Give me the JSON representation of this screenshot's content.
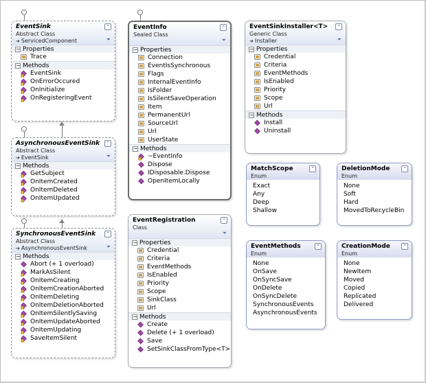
{
  "boxes": {
    "eventsink": {
      "title": "EventSink",
      "kind": "Abstract Class",
      "base": "ServicedComponent",
      "props_label": "Properties",
      "props": [
        "Trace"
      ],
      "methods_label": "Methods",
      "methods": [
        "EventSink",
        "OnErrorOccured",
        "OnInitialize",
        "OnRegisteringEvent"
      ]
    },
    "async": {
      "title": "AsynchronousEventSink",
      "kind": "Abstract Class",
      "base": "EventSink",
      "methods_label": "Methods",
      "methods": [
        "GetSubject",
        "OnItemCreated",
        "OnItemDeleted",
        "OnItemUpdated"
      ]
    },
    "sync": {
      "title": "SynchronousEventSink",
      "kind": "Abstract Class",
      "base": "AsynchronousEventSink",
      "methods_label": "Methods",
      "methods": [
        "Abort (+ 1 overload)",
        "MarkAsSilent",
        "OnItemCreating",
        "OnItemCreationAborted",
        "OnItemDeleting",
        "OnItemDeletionAborted",
        "OnItemSilentlySaving",
        "OnItemUpdateAborted",
        "OnItemUpdating",
        "SaveItemSilent"
      ]
    },
    "eventinfo": {
      "title": "EventInfo",
      "kind": "Sealed Class",
      "props_label": "Properties",
      "props": [
        "Connection",
        "EventIsSynchronous",
        "Flags",
        "InternalEventInfo",
        "IsFolder",
        "IsSilentSaveOperation",
        "Item",
        "PermanentUrl",
        "SourceUrl",
        "Url",
        "UserState"
      ],
      "methods_label": "Methods",
      "methods": [
        "~EventInfo",
        "Dispose",
        "IDisposable.Dispose",
        "OpenItemLocally"
      ]
    },
    "eventreg": {
      "title": "EventRegistration",
      "kind": "Class",
      "props_label": "Properties",
      "props": [
        "Credential",
        "Criteria",
        "EventMethods",
        "IsEnabled",
        "Priority",
        "Scope",
        "SinkClass",
        "Url"
      ],
      "methods_label": "Methods",
      "methods": [
        "Create",
        "Delete (+ 1 overload)",
        "Save",
        "SetSinkClassFromType<T>"
      ]
    },
    "installer": {
      "title": "EventSinkInstaller<T>",
      "kind": "Generic Class",
      "base": "Installer",
      "props_label": "Properties",
      "props": [
        "Credential",
        "Criteria",
        "EventMethods",
        "IsEnabled",
        "Priority",
        "Scope",
        "Url"
      ],
      "methods_label": "Methods",
      "methods": [
        "Install",
        "Uninstall"
      ]
    },
    "matchscope": {
      "title": "MatchScope",
      "kind": "Enum",
      "values": [
        "Exact",
        "Any",
        "Deep",
        "Shallow"
      ]
    },
    "deletionmode": {
      "title": "DeletionMode",
      "kind": "Enum",
      "values": [
        "None",
        "Soft",
        "Hard",
        "MovedToRecycleBin"
      ]
    },
    "eventmethods": {
      "title": "EventMethods",
      "kind": "Enum",
      "values": [
        "None",
        "OnSave",
        "OnSyncSave",
        "OnDelete",
        "OnSyncDelete",
        "SynchronousEvents",
        "AsynchronousEvents"
      ]
    },
    "creationmode": {
      "title": "CreationMode",
      "kind": "Enum",
      "values": [
        "None",
        "NewItem",
        "Moved",
        "Copied",
        "Replicated",
        "Delivered"
      ]
    }
  },
  "icons": {
    "collapse": "double-chevron-up-icon",
    "filter": "filter-icon",
    "property": "property-icon",
    "method": "method-icon"
  }
}
